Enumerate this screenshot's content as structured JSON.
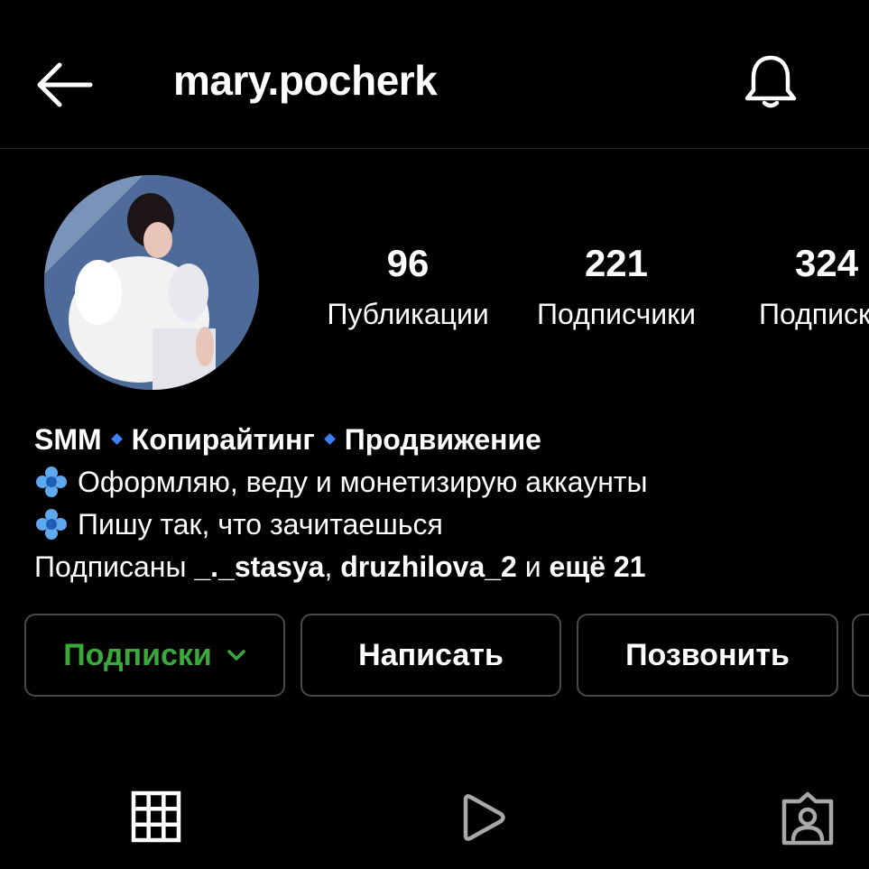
{
  "header": {
    "username": "mary.pocherk"
  },
  "stats": [
    {
      "value": "96",
      "label": "Публикации"
    },
    {
      "value": "221",
      "label": "Подписчики"
    },
    {
      "value": "324",
      "label": "Подписки"
    }
  ],
  "bio": {
    "tag1": "SMM",
    "tag2": "Копирайтинг",
    "tag3": "Продвижение",
    "line2": "Оформляю, веду и монетизирую аккаунты",
    "line3": "Пишу так, что зачитаешься",
    "followed_prefix": "Подписаны ",
    "followed_user1": "_._stasya",
    "followed_sep": ", ",
    "followed_user2": "druzhilova_2",
    "followed_and": " и ",
    "followed_more": "ещё 21"
  },
  "buttons": {
    "following": "Подписки",
    "message": "Написать",
    "call": "Позвонить"
  },
  "colors": {
    "background": "#000000",
    "following_accent": "#3aa83a",
    "bio_diamond": "#3b82f6",
    "button_border": "#4a4a4a"
  },
  "icons": {
    "back": "back-arrow-icon",
    "bell": "bell-icon",
    "grid": "grid-icon",
    "reels": "play-icon",
    "tagged": "tagged-user-icon"
  }
}
